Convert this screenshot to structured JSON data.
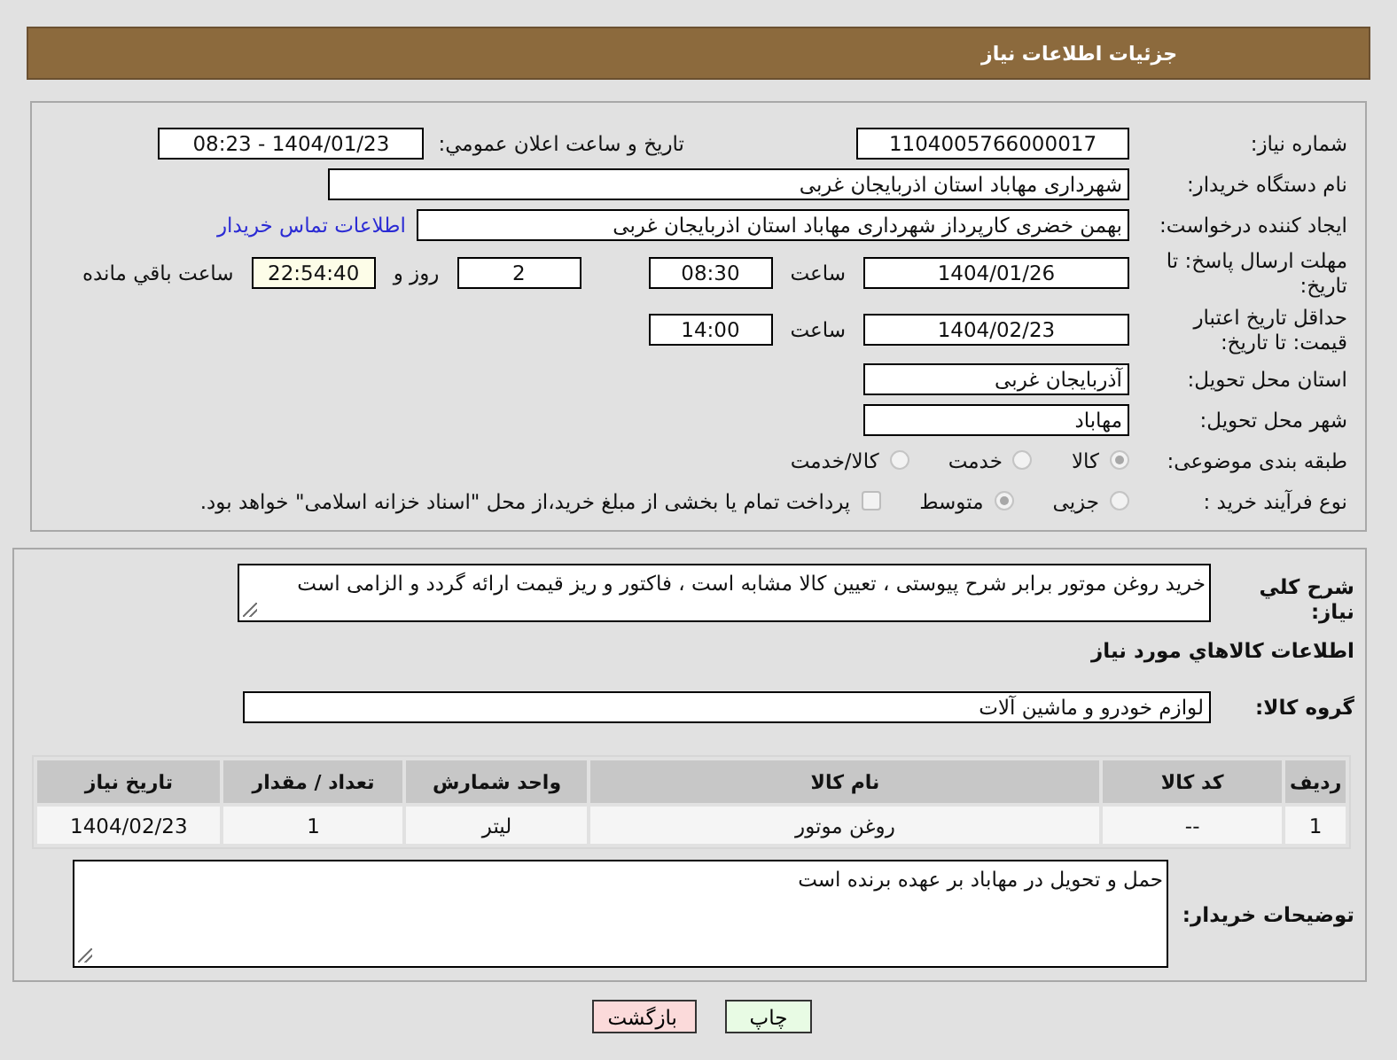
{
  "header": {
    "title": "جزئیات اطلاعات نیاز"
  },
  "details": {
    "need_number": {
      "label": "شماره نیاز:",
      "value": "1104005766000017"
    },
    "announce": {
      "label": "تاریخ و ساعت اعلان عمومي:",
      "value": "1404/01/23 - 08:23"
    },
    "buyer": {
      "label": "نام دستگاه خریدار:",
      "value": "شهرداری مهاباد استان اذربایجان غربی"
    },
    "creator": {
      "label": "ایجاد کننده درخواست:",
      "value": "بهمن خضری کارپرداز شهرداری مهاباد استان اذربایجان غربی",
      "link": "اطلاعات تماس خریدار"
    },
    "reply_deadline": {
      "label": "مهلت ارسال پاسخ: تا تاریخ:",
      "date": "1404/01/26",
      "time_label": "ساعت",
      "time": "08:30",
      "days": "2",
      "days_label": "روز و",
      "remaining": "22:54:40",
      "remaining_label": "ساعت باقي مانده"
    },
    "price_validity": {
      "label": "حداقل تاریخ اعتبار قیمت: تا تاریخ:",
      "date": "1404/02/23",
      "time_label": "ساعت",
      "time": "14:00"
    },
    "province": {
      "label": "استان محل تحویل:",
      "value": "آذربایجان غربی"
    },
    "city": {
      "label": "شهر محل تحویل:",
      "value": "مهاباد"
    },
    "category": {
      "label": "طبقه بندی موضوعی:",
      "options": [
        {
          "label": "کالا",
          "selected": true
        },
        {
          "label": "خدمت",
          "selected": false
        },
        {
          "label": "کالا/خدمت",
          "selected": false
        }
      ]
    },
    "process": {
      "label": "نوع فرآیند خرید :",
      "options": [
        {
          "label": "جزیی",
          "selected": false
        },
        {
          "label": "متوسط",
          "selected": true
        }
      ],
      "treasury": {
        "label": "پرداخت تمام یا بخشی از مبلغ خرید،از محل \"اسناد خزانه اسلامی\" خواهد بود.",
        "checked": false
      }
    }
  },
  "goods": {
    "description": {
      "label": "شرح کلي نیاز:",
      "value": "خرید روغن موتور برابر شرح پیوستی ،  تعیین کالا مشابه است ، فاکتور و ریز قیمت ارائه گردد و الزامی است"
    },
    "section_title": "اطلاعات کالاهاي مورد نیاز",
    "group": {
      "label": "گروه کالا:",
      "value": "لوازم خودرو و ماشین آلات"
    },
    "table": {
      "columns": [
        "ردیف",
        "کد کالا",
        "نام کالا",
        "واحد شمارش",
        "تعداد / مقدار",
        "تاریخ نیاز"
      ],
      "rows": [
        [
          "1",
          "--",
          "روغن موتور",
          "لیتر",
          "1",
          "1404/02/23"
        ]
      ]
    },
    "buyer_notes": {
      "label": "توضیحات خریدار:",
      "value": "حمل و تحویل در مهاباد بر عهده برنده است"
    }
  },
  "buttons": [
    {
      "label": "چاپ",
      "kind": "print"
    },
    {
      "label": "بازگشت",
      "kind": "back"
    }
  ]
}
